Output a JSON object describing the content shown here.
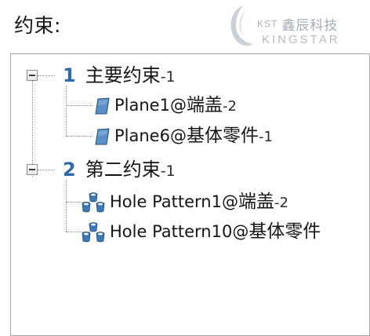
{
  "panel": {
    "title": "约束:"
  },
  "watermark": {
    "prefix": "KST",
    "company_cn": "鑫辰科技",
    "company_en": "KINGSTAR"
  },
  "tree": {
    "groups": [
      {
        "number": "1",
        "name": "主要约束",
        "suffix": "-1",
        "expanded": true,
        "items": [
          {
            "name": "Plane1@",
            "part": "端盖",
            "suffix": "-2",
            "icon": "plane-icon"
          },
          {
            "name": "Plane6@",
            "part": "基体零件",
            "suffix": "-1",
            "icon": "plane-icon"
          }
        ]
      },
      {
        "number": "2",
        "name": "第二约束",
        "suffix": "-1",
        "expanded": true,
        "items": [
          {
            "name": "Hole Pattern1@",
            "part": "端盖",
            "suffix": "-2",
            "icon": "hole-pattern-icon"
          },
          {
            "name": "Hole Pattern10@",
            "part": "基体零件",
            "suffix": "",
            "icon": "hole-pattern-icon"
          }
        ]
      }
    ]
  },
  "colors": {
    "group_number": "#2c6aa8",
    "plane_icon": "#5b8fc7",
    "hole_icon": "#3f78b8"
  }
}
